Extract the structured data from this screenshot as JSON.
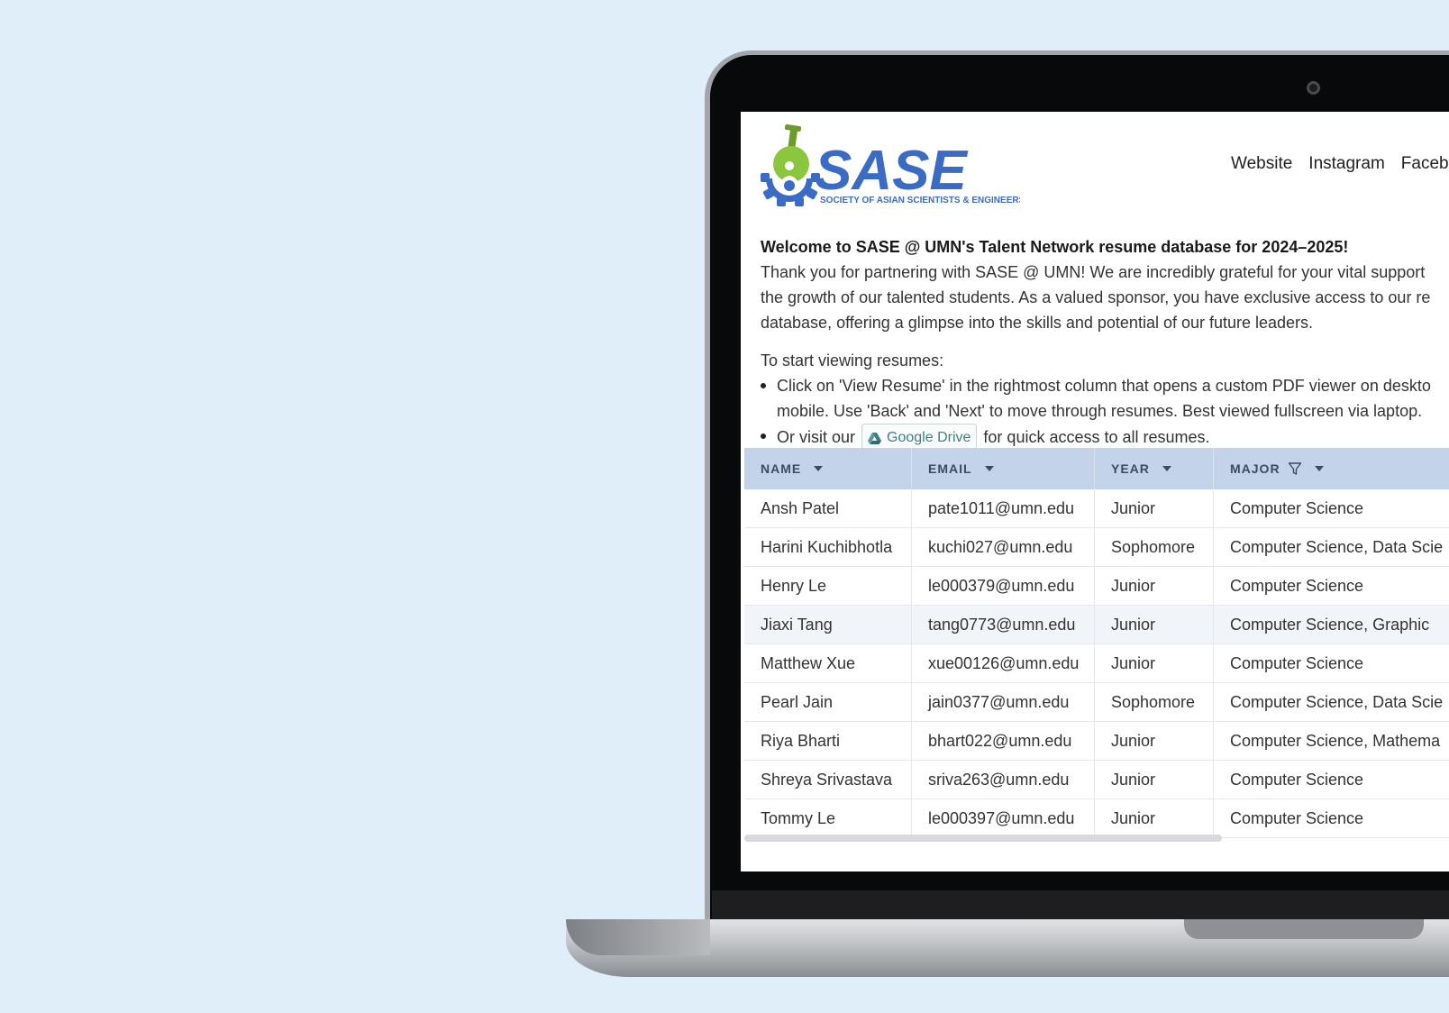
{
  "logo": {
    "brand": "SASE",
    "tagline": "SOCIETY OF ASIAN SCIENTISTS & ENGINEERS"
  },
  "nav": [
    "Website",
    "Instagram",
    "Faceb"
  ],
  "intro": {
    "heading": "Welcome to SASE @ UMN's Talent Network resume database for 2024–2025!",
    "paragraph_lines": [
      "Thank you for partnering with SASE @ UMN! We are incredibly grateful for your vital support",
      "the growth of our talented students. As a valued sponsor, you have exclusive access to our re",
      "database, offering a glimpse into the skills and potential of our future leaders."
    ],
    "start_label": "To start viewing resumes:",
    "bullet1_lines": [
      "Click on 'View Resume' in the rightmost column that opens a custom PDF viewer on deskto",
      "mobile. Use 'Back' and 'Next' to move through resumes. Best viewed fullscreen via laptop."
    ],
    "bullet2_before": "Or visit our",
    "drive_label": "Google Drive",
    "bullet2_after": "for quick access to all resumes."
  },
  "table": {
    "columns": [
      "NAME",
      "EMAIL",
      "YEAR",
      "MAJOR"
    ],
    "rows": [
      [
        "Ansh Patel",
        "pate1011@umn.edu",
        "Junior",
        "Computer Science"
      ],
      [
        "Harini Kuchibhotla",
        "kuchi027@umn.edu",
        "Sophomore",
        "Computer Science, Data Scie"
      ],
      [
        "Henry Le",
        "le000379@umn.edu",
        "Junior",
        "Computer Science"
      ],
      [
        "Jiaxi Tang",
        "tang0773@umn.edu",
        "Junior",
        "Computer Science, Graphic"
      ],
      [
        "Matthew Xue",
        "xue00126@umn.edu",
        "Junior",
        "Computer Science"
      ],
      [
        "Pearl Jain",
        "jain0377@umn.edu",
        "Sophomore",
        "Computer Science, Data Scie"
      ],
      [
        "Riya Bharti",
        "bhart022@umn.edu",
        "Junior",
        "Computer Science, Mathema"
      ],
      [
        "Shreya Srivastava",
        "sriva263@umn.edu",
        "Junior",
        "Computer Science"
      ],
      [
        "Tommy Le",
        "le000397@umn.edu",
        "Junior",
        "Computer Science"
      ]
    ],
    "highlighted_row": 3
  },
  "colors": {
    "brand_blue": "#3b6cc5",
    "brand_green": "#8cc63f",
    "header_bg": "#c3d3ea",
    "background": "#e0eefa"
  }
}
